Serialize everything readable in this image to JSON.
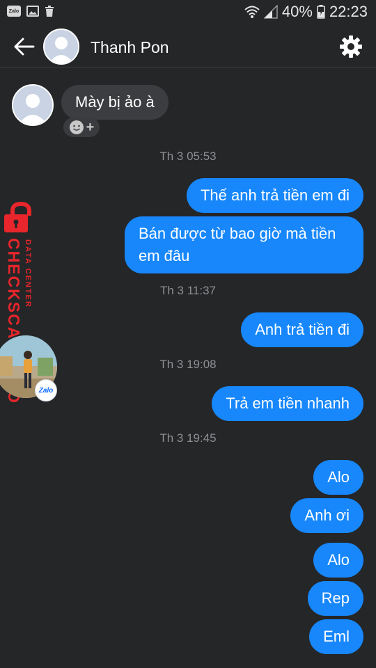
{
  "status_bar": {
    "notif_app": "Zalo",
    "battery": "40%",
    "time": "22:23"
  },
  "header": {
    "contact_name": "Thanh Pon"
  },
  "received": [
    {
      "text": "Mày bị ảo à"
    }
  ],
  "timestamps": [
    "Th 3 05:53",
    "Th 3 11:37",
    "Th 3 19:08",
    "Th 3 19:45"
  ],
  "sent": [
    {
      "text": "Thế anh trả tiền em đi"
    },
    {
      "text": "Bán được từ bao giờ mà tiền em đâu"
    },
    {
      "text": "Anh trả tiền đi"
    },
    {
      "text": "Trả em tiền nhanh"
    },
    {
      "text": "Alo"
    },
    {
      "text": "Anh ơi"
    },
    {
      "text": "Alo"
    },
    {
      "text": "Rep"
    },
    {
      "text": "Eml"
    }
  ],
  "watermark": {
    "brand": "CHECKSCAM.INFO",
    "sub": "DATA CENTER"
  },
  "chat_head": {
    "badge": "Zalo"
  },
  "colors": {
    "background": "#252628",
    "sent_bubble": "#1787fb",
    "received_bubble": "#3c3d40",
    "timestamp": "#8e8f93",
    "watermark": "#e8262c"
  },
  "icons": [
    "back-arrow-icon",
    "gear-icon",
    "smiley-icon",
    "wifi-icon",
    "signal-icon",
    "battery-icon",
    "gallery-icon",
    "trash-icon",
    "lock-icon"
  ]
}
